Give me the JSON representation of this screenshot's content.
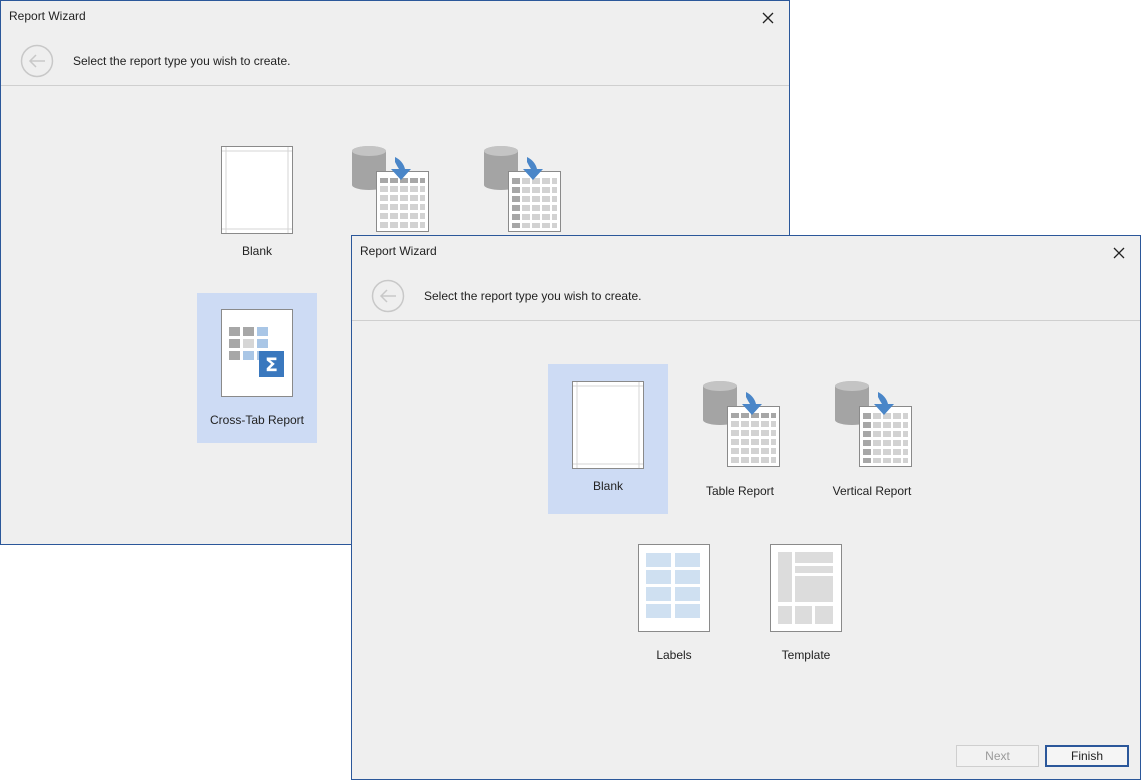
{
  "back_dialog": {
    "title": "Report Wizard",
    "instruction": "Select the report type you wish to create.",
    "tiles": [
      {
        "label": "Blank",
        "icon": "blank-page-icon"
      },
      {
        "label": "",
        "icon": "table-report-icon"
      },
      {
        "label": "",
        "icon": "vertical-report-icon"
      },
      {
        "label": "Cross-Tab Report",
        "icon": "cross-tab-report-icon",
        "selected": true
      }
    ]
  },
  "front_dialog": {
    "title": "Report Wizard",
    "instruction": "Select the report type you wish to create.",
    "tiles": [
      {
        "label": "Blank",
        "icon": "blank-page-icon",
        "selected": true
      },
      {
        "label": "Table Report",
        "icon": "table-report-icon"
      },
      {
        "label": "Vertical Report",
        "icon": "vertical-report-icon"
      },
      {
        "label": "Labels",
        "icon": "labels-icon"
      },
      {
        "label": "Template",
        "icon": "template-icon"
      }
    ],
    "buttons": {
      "next": "Next",
      "finish": "Finish"
    }
  },
  "colors": {
    "accent": "#2b579a",
    "selection": "#cddbf4",
    "arrow_blue": "#4a86c8"
  }
}
